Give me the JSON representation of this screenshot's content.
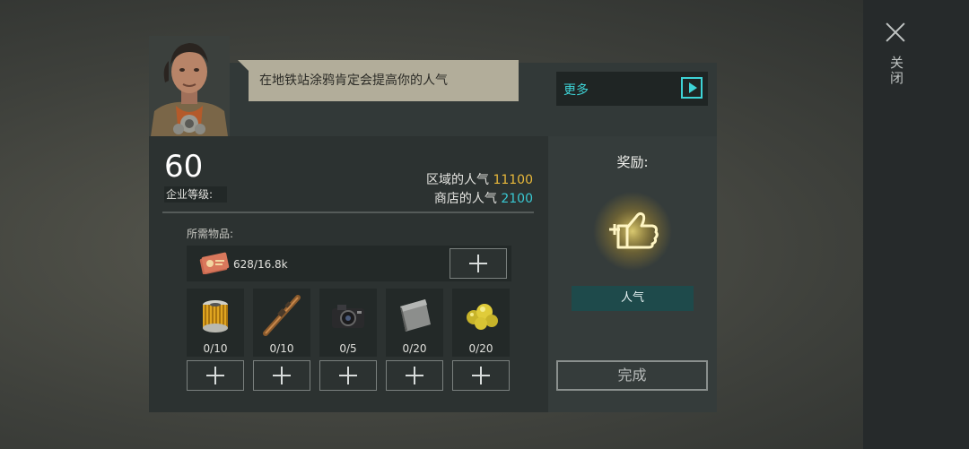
{
  "close": {
    "label": "关闭",
    "icon": "close-icon"
  },
  "dialog": {
    "speech": "在地铁站涂鸦肯定会提高你的人气",
    "more_label": "更多"
  },
  "level": {
    "value": "60",
    "label": "企业等级:"
  },
  "popularity": {
    "area_label": "区域的人气",
    "area_value": "11100",
    "shop_label": "商店的人气",
    "shop_value": "2100",
    "gold_color": "#e8b83a",
    "cyan_color": "#39c8d2"
  },
  "requirements": {
    "label": "所需物品:",
    "main_item": {
      "icon": "graffiti-ticket-icon",
      "count": "628/16.8k"
    },
    "items": [
      {
        "icon": "oil-filter-icon",
        "count": "0/10"
      },
      {
        "icon": "wooden-stick-icon",
        "count": "0/10"
      },
      {
        "icon": "camera-icon",
        "count": "0/5"
      },
      {
        "icon": "metal-plate-icon",
        "count": "0/20"
      },
      {
        "icon": "gold-nuggets-icon",
        "count": "0/20"
      }
    ]
  },
  "reward": {
    "title": "奖励:",
    "icon": "popularity-thumbs-up-icon",
    "badge": "人气"
  },
  "complete_label": "完成"
}
